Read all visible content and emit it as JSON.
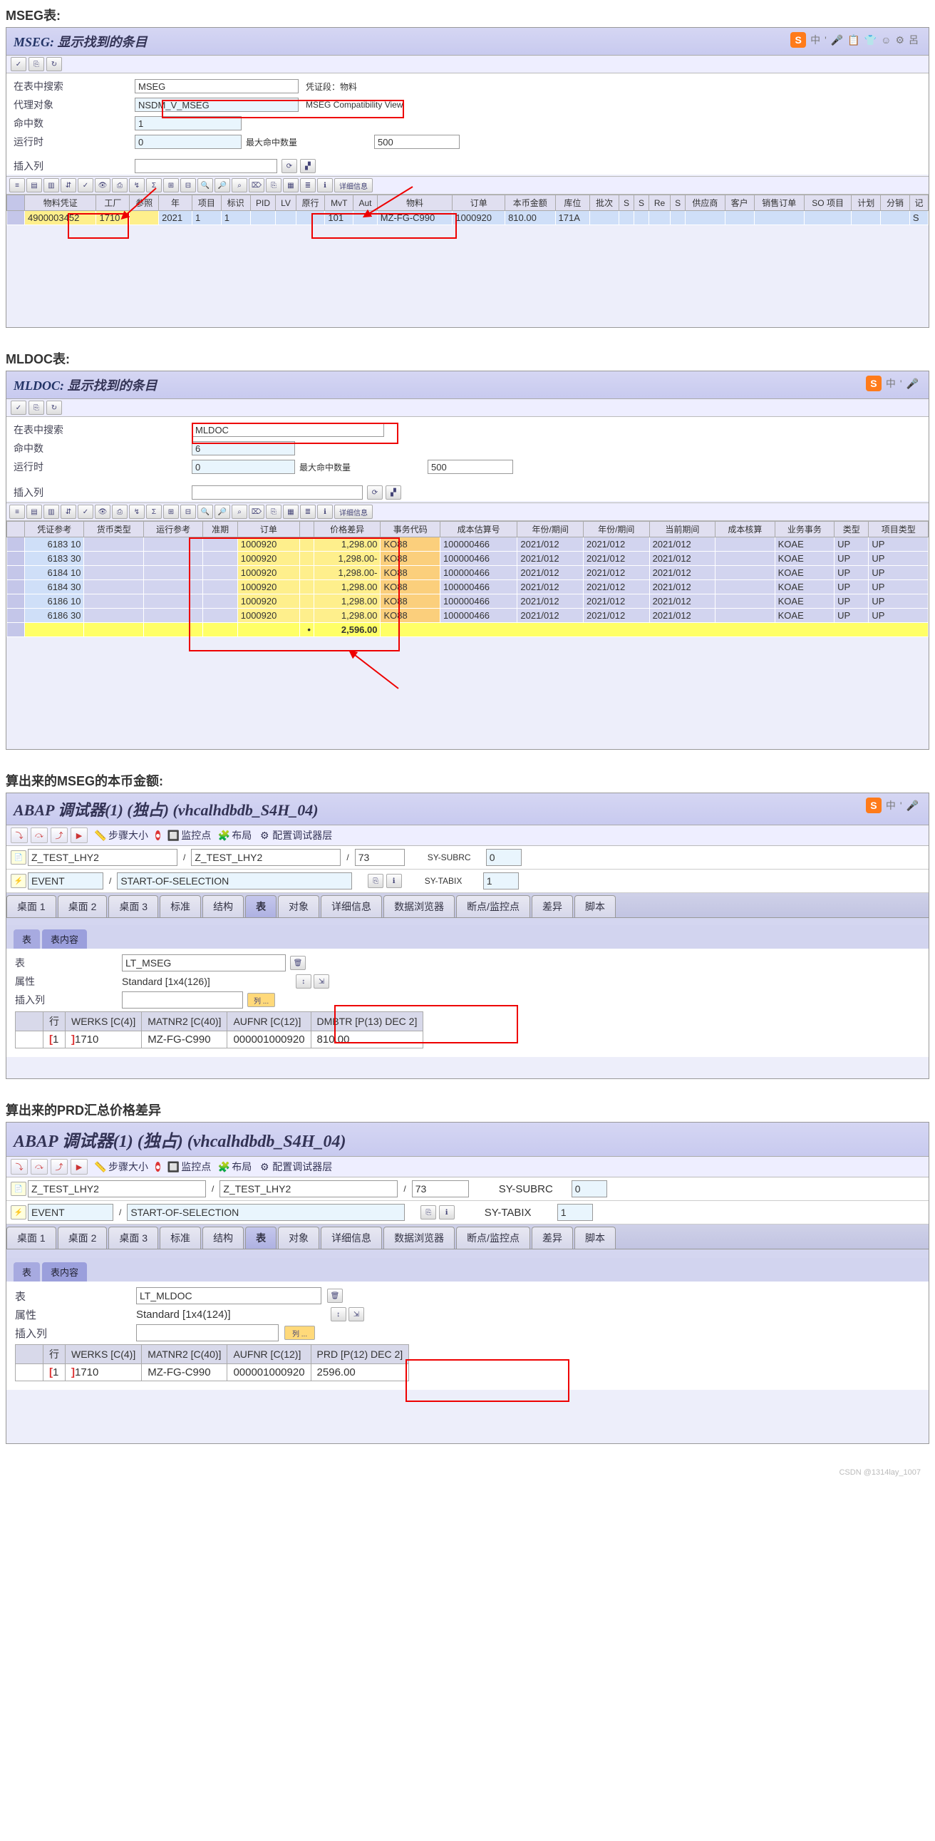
{
  "sections": {
    "mseg_title": "MSEG表:",
    "mldoc_title": "MLDOC表:",
    "dbg1_title": "算出来的MSEG的本币金额:",
    "dbg2_title": "算出来的PRD汇总价格差异"
  },
  "mseg": {
    "header": {
      "name": "MSEG:",
      "sub": "显示找到的条目"
    },
    "form": {
      "search_lbl": "在表中搜索",
      "search_val": "MSEG",
      "search_note": "凭证段：物料",
      "proxy_lbl": "代理对象",
      "proxy_val": "NSDM_V_MSEG",
      "proxy_note": "MSEG Compatibility View",
      "hits_lbl": "命中数",
      "hits_val": "1",
      "rt_lbl": "运行时",
      "rt_val": "0",
      "max_lbl": "最大命中数量",
      "max_val": "500",
      "ins_lbl": "插入列",
      "ins_val": "",
      "detail_btn": "详细信息"
    },
    "cols": [
      "物料凭证",
      "工厂",
      "参照",
      "年",
      "项目",
      "标识",
      "PID",
      "LV",
      "原行",
      "MvT",
      "Aut",
      "物料",
      "订单",
      "本币金额",
      "库位",
      "批次",
      "S",
      "S",
      "Re",
      "S",
      "供应商",
      "客户",
      "销售订单",
      "SO 项目",
      "计划",
      "分销",
      "记"
    ],
    "row": [
      "4900003452",
      "1710",
      "",
      "2021",
      "1",
      "1",
      "",
      "",
      "",
      "101",
      "",
      "MZ-FG-C990",
      "1000920",
      "810.00",
      "171A",
      "",
      "",
      "",
      "",
      "",
      "",
      "",
      "",
      "",
      "",
      "",
      "S"
    ]
  },
  "mldoc": {
    "header": {
      "name": "MLDOC:",
      "sub": "显示找到的条目"
    },
    "form": {
      "search_lbl": "在表中搜索",
      "search_val": "MLDOC",
      "hits_lbl": "命中数",
      "hits_val": "6",
      "rt_lbl": "运行时",
      "rt_val": "0",
      "max_lbl": "最大命中数量",
      "max_val": "500",
      "ins_lbl": "插入列",
      "ins_val": "",
      "detail_btn": "详细信息"
    },
    "cols": [
      "",
      "凭证参考",
      "货币类型",
      "运行参考",
      "准期",
      "订单",
      "",
      "价格差异",
      "事务代码",
      "成本估算号",
      "年份/期间",
      "年份/期间",
      "当前期间",
      "成本核算",
      "业务事务",
      "类型",
      "项目类型"
    ],
    "rows": [
      {
        "ref": "6183 10",
        "order": "1000920",
        "diff": "1,298.00",
        "tc": "KO88",
        "cen": "100000466",
        "p1": "2021/012",
        "p2": "2021/012",
        "p3": "2021/012",
        "bt": "KOAE",
        "t1": "UP",
        "t2": "UP"
      },
      {
        "ref": "6183 30",
        "order": "1000920",
        "diff": "1,298.00-",
        "tc": "KO88",
        "cen": "100000466",
        "p1": "2021/012",
        "p2": "2021/012",
        "p3": "2021/012",
        "bt": "KOAE",
        "t1": "UP",
        "t2": "UP"
      },
      {
        "ref": "6184 10",
        "order": "1000920",
        "diff": "1,298.00-",
        "tc": "KO88",
        "cen": "100000466",
        "p1": "2021/012",
        "p2": "2021/012",
        "p3": "2021/012",
        "bt": "KOAE",
        "t1": "UP",
        "t2": "UP"
      },
      {
        "ref": "6184 30",
        "order": "1000920",
        "diff": "1,298.00",
        "tc": "KO88",
        "cen": "100000466",
        "p1": "2021/012",
        "p2": "2021/012",
        "p3": "2021/012",
        "bt": "KOAE",
        "t1": "UP",
        "t2": "UP"
      },
      {
        "ref": "6186 10",
        "order": "1000920",
        "diff": "1,298.00",
        "tc": "KO88",
        "cen": "100000466",
        "p1": "2021/012",
        "p2": "2021/012",
        "p3": "2021/012",
        "bt": "KOAE",
        "t1": "UP",
        "t2": "UP"
      },
      {
        "ref": "6186 30",
        "order": "1000920",
        "diff": "1,298.00",
        "tc": "KO88",
        "cen": "100000466",
        "p1": "2021/012",
        "p2": "2021/012",
        "p3": "2021/012",
        "bt": "KOAE",
        "t1": "UP",
        "t2": "UP"
      }
    ],
    "sum_diff": "2,596.00",
    "sum_mark": "•"
  },
  "dbg_common": {
    "title_pre": "ABAP 调试器(1)  (独占)",
    "title_host": "(vhcalhdbdb_S4H_04)",
    "step_lbl": "步骤大小",
    "bp_lbl": "监控点",
    "layout_lbl": "布局",
    "cfg_lbl": "配置调试器层",
    "prog": "Z_TEST_LHY2",
    "incl": "Z_TEST_LHY2",
    "line": "73",
    "subrc_lbl": "SY-SUBRC",
    "subrc": "0",
    "tabix_lbl": "SY-TABIX",
    "tabix": "1",
    "evtype_lbl": "EVENT",
    "evt": "START-OF-SELECTION",
    "tabs": [
      "桌面 1",
      "桌面 2",
      "桌面 3",
      "标准",
      "结构",
      "表",
      "对象",
      "详细信息",
      "数据浏览器",
      "断点/监控点",
      "差异",
      "脚本"
    ],
    "subtabs": [
      "表",
      "表内容"
    ],
    "tbl_lbl": "表",
    "attr_lbl": "属性",
    "ins_lbl": "插入列",
    "col_btn": "列 ...",
    "row_lbl": "行"
  },
  "dbg1": {
    "table": "LT_MSEG",
    "attr": "Standard [1x4(126)]",
    "cols": [
      "行",
      "WERKS [C(4)]",
      "MATNR2 [C(40)]",
      "AUFNR [C(12)]",
      "DMBTR [P(13) DEC 2]"
    ],
    "row": [
      "1",
      "1710",
      "MZ-FG-C990",
      "000001000920",
      "810.00"
    ]
  },
  "dbg2": {
    "table": "LT_MLDOC",
    "attr": "Standard [1x4(124)]",
    "cols": [
      "行",
      "WERKS [C(4)]",
      "MATNR2 [C(40)]",
      "AUFNR [C(12)]",
      "PRD [P(12) DEC 2]"
    ],
    "row": [
      "1",
      "1710",
      "MZ-FG-C990",
      "000001000920",
      "2596.00"
    ]
  },
  "sogou": {
    "items": [
      "中",
      "'",
      "🎤",
      "📋",
      "👕",
      "☺",
      "⚙",
      "呂"
    ]
  },
  "footer": "CSDN @1314lay_1007"
}
